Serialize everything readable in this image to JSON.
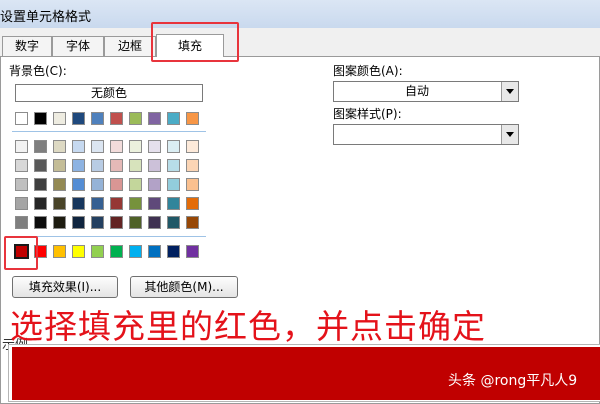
{
  "window": {
    "title": "设置单元格格式"
  },
  "tabs": [
    {
      "label": "数字",
      "active": false
    },
    {
      "label": "字体",
      "active": false
    },
    {
      "label": "边框",
      "active": false
    },
    {
      "label": "填充",
      "active": true
    }
  ],
  "fill": {
    "background_label": "背景色(C):",
    "no_color_label": "无颜色",
    "palette": {
      "theme_top": [
        "#ffffff",
        "#000000",
        "#eeece1",
        "#1f497d",
        "#4f81bd",
        "#c0504d",
        "#9bbb59",
        "#8064a2",
        "#4bacc6",
        "#f79646"
      ],
      "theme_shades": [
        [
          "#f2f2f2",
          "#7f7f7f",
          "#ddd9c3",
          "#c6d9f0",
          "#dbe5f1",
          "#f2dcdb",
          "#ebf1dd",
          "#e5e0ec",
          "#dbeef3",
          "#fdeada"
        ],
        [
          "#d8d8d8",
          "#595959",
          "#c4bd97",
          "#8db3e2",
          "#b8cce4",
          "#e5b9b7",
          "#d7e3bc",
          "#ccc1d9",
          "#b7dde8",
          "#fbd5b5"
        ],
        [
          "#bfbfbf",
          "#3f3f3f",
          "#938953",
          "#548dd4",
          "#95b3d7",
          "#d99694",
          "#c3d69b",
          "#b2a2c7",
          "#92cddc",
          "#fac08f"
        ],
        [
          "#a5a5a5",
          "#262626",
          "#494429",
          "#17365d",
          "#366092",
          "#953734",
          "#76923c",
          "#5f497a",
          "#31859b",
          "#e36c09"
        ],
        [
          "#7f7f7f",
          "#0c0c0c",
          "#1d1b10",
          "#0f243e",
          "#244061",
          "#632423",
          "#4f6128",
          "#3f3151",
          "#205867",
          "#974806"
        ]
      ],
      "standard": [
        "#c00000",
        "#ff0000",
        "#ffc000",
        "#ffff00",
        "#92d050",
        "#00b050",
        "#00b0f0",
        "#0070c0",
        "#002060",
        "#7030a0"
      ],
      "selected_color": "#c00000"
    },
    "fill_effects_label": "填充效果(I)...",
    "more_colors_label": "其他颜色(M)...",
    "pattern_color_label": "图案颜色(A):",
    "pattern_color_value": "自动",
    "pattern_style_label": "图案样式(P):",
    "pattern_style_value": ""
  },
  "preview": {
    "label": "示例",
    "color": "#c00000"
  },
  "annotation": {
    "caption": "选择填充里的红色，并点击确定",
    "caption_color": "#e4121a"
  },
  "watermark": {
    "text": "头条 @rong平凡人9"
  }
}
